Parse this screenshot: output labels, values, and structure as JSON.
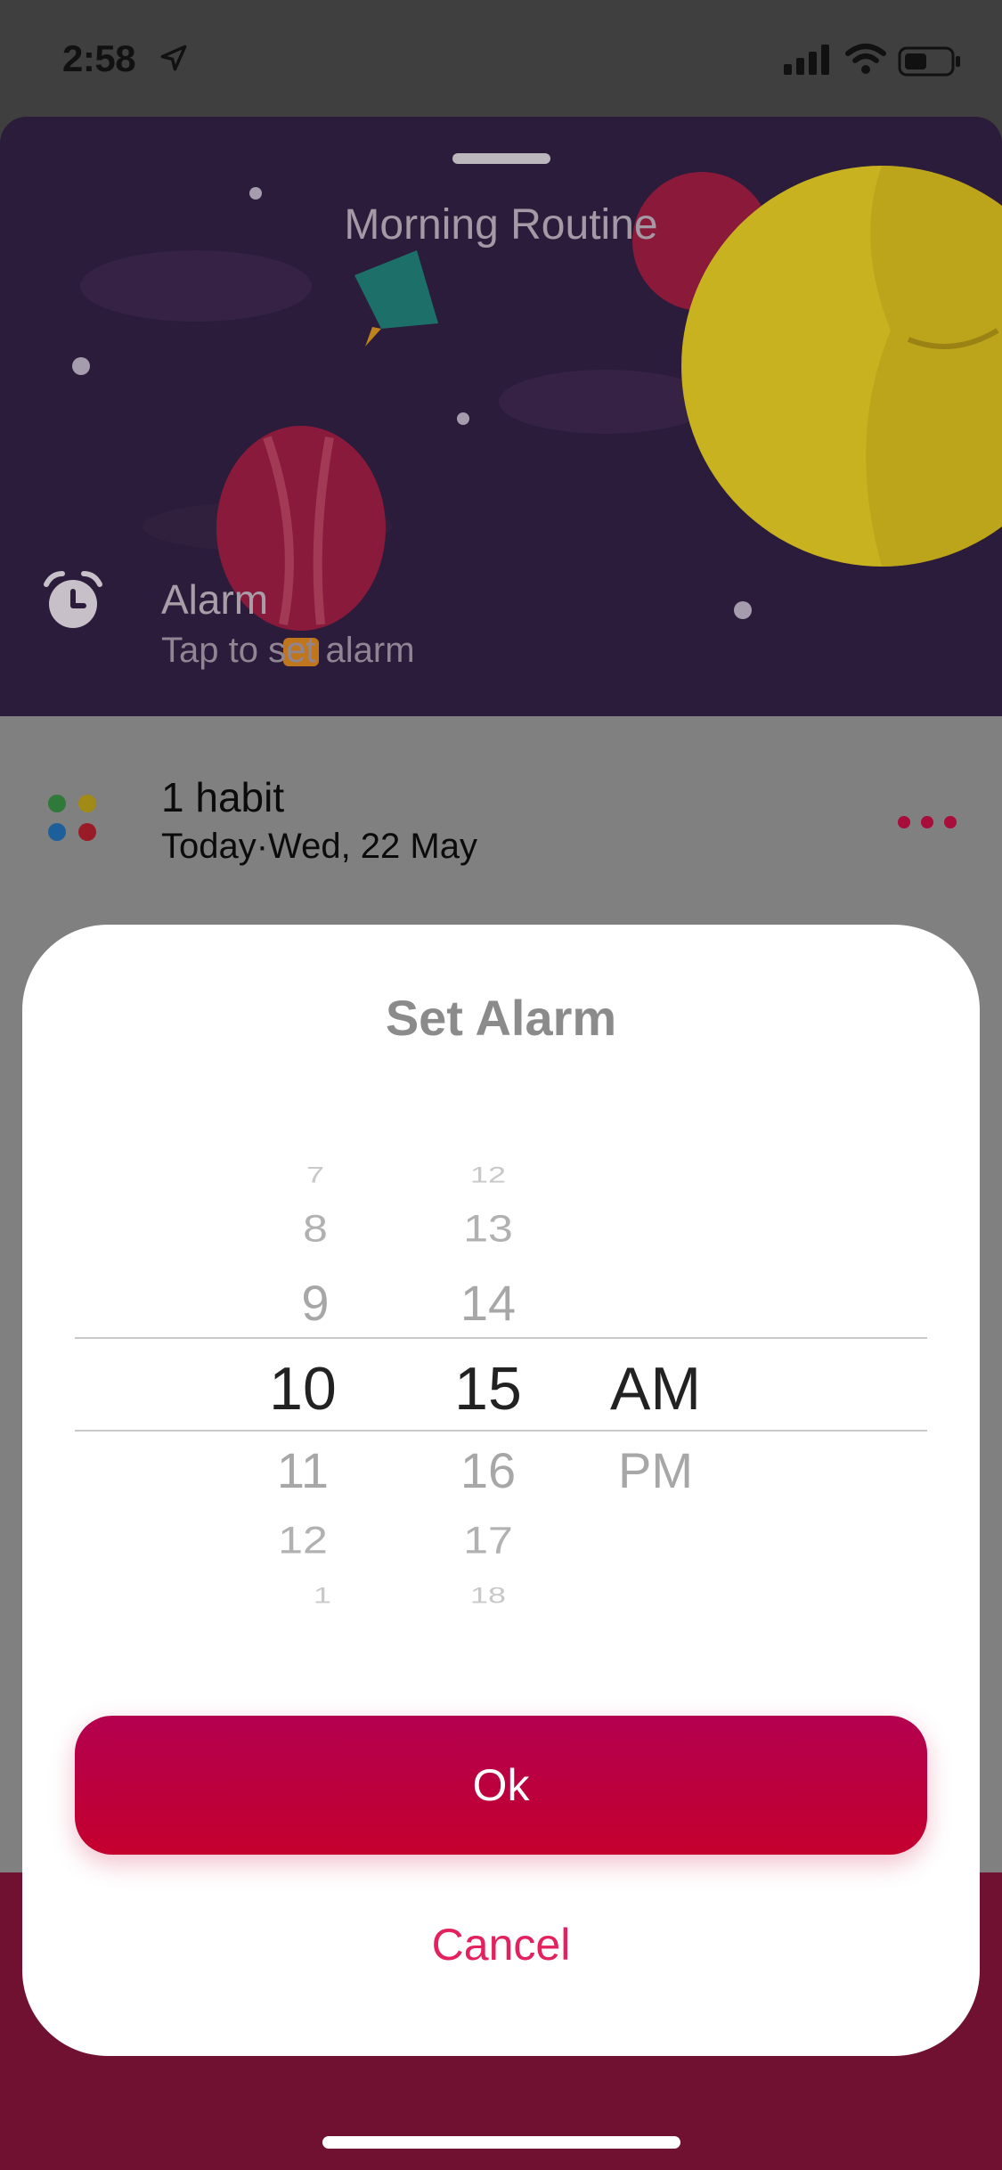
{
  "status_bar": {
    "time": "2:58"
  },
  "hero": {
    "title": "Morning Routine"
  },
  "alarm": {
    "title": "Alarm",
    "subtitle": "Tap to set alarm"
  },
  "habit": {
    "count": "1 habit",
    "date": "Today·Wed, 22 May"
  },
  "dialog": {
    "title": "Set Alarm",
    "picker": {
      "hours": {
        "faded_above": [
          "7",
          "8",
          "9"
        ],
        "selected": "10",
        "faded_below": [
          "11",
          "12",
          "1"
        ]
      },
      "minutes": {
        "faded_above": [
          "12",
          "13",
          "14"
        ],
        "selected": "15",
        "faded_below": [
          "16",
          "17",
          "18"
        ]
      },
      "period": {
        "selected": "AM",
        "options_below": [
          "PM"
        ]
      }
    },
    "ok_label": "Ok",
    "cancel_label": "Cancel"
  },
  "colors": {
    "accent": "#c4002e",
    "cancel": "#e3215f",
    "hero_bg": "#2a1c3a"
  }
}
